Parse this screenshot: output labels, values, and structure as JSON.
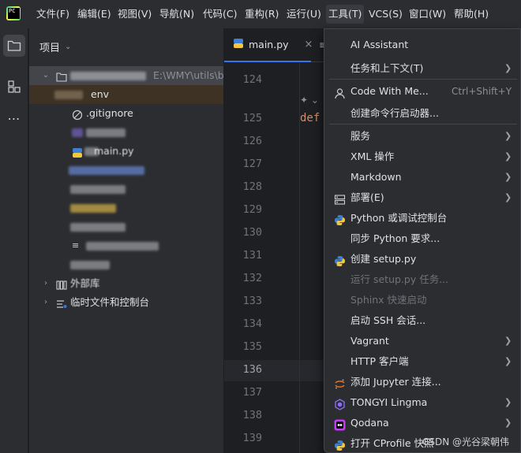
{
  "menubar": {
    "items": [
      "文件(F)",
      "编辑(E)",
      "视图(V)",
      "导航(N)",
      "代码(C)",
      "重构(R)",
      "运行(U)",
      "工具(T)",
      "VCS(S)",
      "窗口(W)",
      "帮助(H)"
    ]
  },
  "project_panel": {
    "title": "项目",
    "root_path": "E:\\WMY\\utils\\b",
    "items": {
      "venv": "env",
      "gitignore": ".gitignore",
      "main_py": "main.py",
      "external_libs": "外部库",
      "scratches": "临时文件和控制台"
    }
  },
  "editor": {
    "tab_label": "main.py",
    "tab_close": "×",
    "line_numbers": [
      "124",
      "125",
      "126",
      "127",
      "128",
      "129",
      "130",
      "131",
      "132",
      "133",
      "134",
      "135",
      "136",
      "137",
      "138",
      "139"
    ],
    "current_line": "136",
    "code_keyword": "def"
  },
  "tools_menu": {
    "items": [
      {
        "label": "AI Assistant"
      },
      {
        "label": "任务和上下文(T)",
        "submenu": true
      },
      {
        "label": "Code With Me...",
        "shortcut": "Ctrl+Shift+Y",
        "icon": "person-icon"
      },
      {
        "label": "创建命令行启动器..."
      },
      {
        "label": "服务",
        "submenu": true
      },
      {
        "label": "XML 操作",
        "submenu": true
      },
      {
        "label": "Markdown",
        "submenu": true
      },
      {
        "label": "部署(E)",
        "submenu": true,
        "icon": "deployment-icon"
      },
      {
        "label": "Python 或调试控制台",
        "icon": "python-icon"
      },
      {
        "label": "同步 Python 要求..."
      },
      {
        "label": "创建 setup.py",
        "icon": "python-icon"
      },
      {
        "label": "运行 setup.py 任务...",
        "disabled": true
      },
      {
        "label": "Sphinx 快速启动",
        "disabled": true
      },
      {
        "label": "启动 SSH 会话..."
      },
      {
        "label": "Vagrant",
        "submenu": true
      },
      {
        "label": "HTTP 客户端",
        "submenu": true
      },
      {
        "label": "添加 Jupyter 连接...",
        "icon": "jupyter-icon"
      },
      {
        "label": "TONGYI Lingma",
        "submenu": true,
        "icon": "lingma-icon"
      },
      {
        "label": "Qodana",
        "submenu": true,
        "icon": "qodana-icon"
      },
      {
        "label": "打开 CProfile 快照",
        "icon": "python-icon"
      }
    ]
  },
  "watermark": "CSDN @光谷梁朝伟",
  "colors": {
    "menubar_bg": "#2b2d30",
    "editor_bg": "#1e1f22",
    "accent": "#3574f0",
    "keyword": "#cf8e6d",
    "venv_highlight": "#3d3223"
  }
}
